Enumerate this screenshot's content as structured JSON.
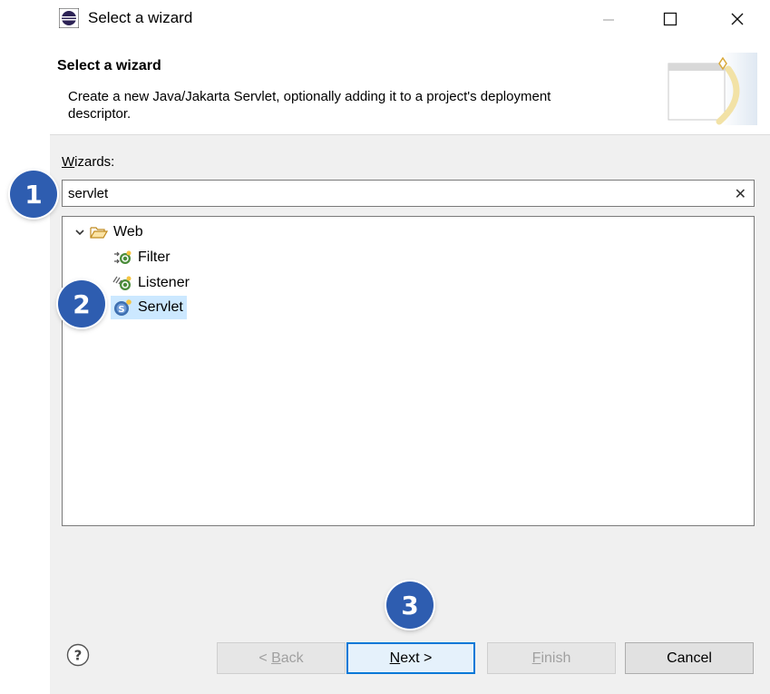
{
  "window": {
    "title": "Select a wizard",
    "icon": "eclipse-icon"
  },
  "banner": {
    "title": "Select a wizard",
    "description": "Create a new Java/Jakarta Servlet, optionally adding it to a project's deployment descriptor."
  },
  "wizards": {
    "label_mnemonic": "W",
    "label_rest": "izards:",
    "search_value": "servlet",
    "clear_icon": "✕"
  },
  "tree": {
    "category": {
      "label": "Web",
      "icon": "folder-open-icon",
      "expanded": true
    },
    "items": [
      {
        "label": "Filter",
        "icon": "filter-icon",
        "selected": false
      },
      {
        "label": "Listener",
        "icon": "listener-icon",
        "selected": false
      },
      {
        "label": "Servlet",
        "icon": "servlet-icon",
        "selected": true
      }
    ]
  },
  "buttons": {
    "back_prefix": "< ",
    "back_mnemonic": "B",
    "back_rest": "ack",
    "next_mnemonic": "N",
    "next_rest": "ext >",
    "finish_mnemonic": "F",
    "finish_rest": "inish",
    "cancel": "Cancel"
  },
  "callouts": [
    "1",
    "2",
    "3"
  ],
  "colors": {
    "accent": "#0078d7",
    "selection": "#cce8ff",
    "badge": "#2e5db0"
  }
}
